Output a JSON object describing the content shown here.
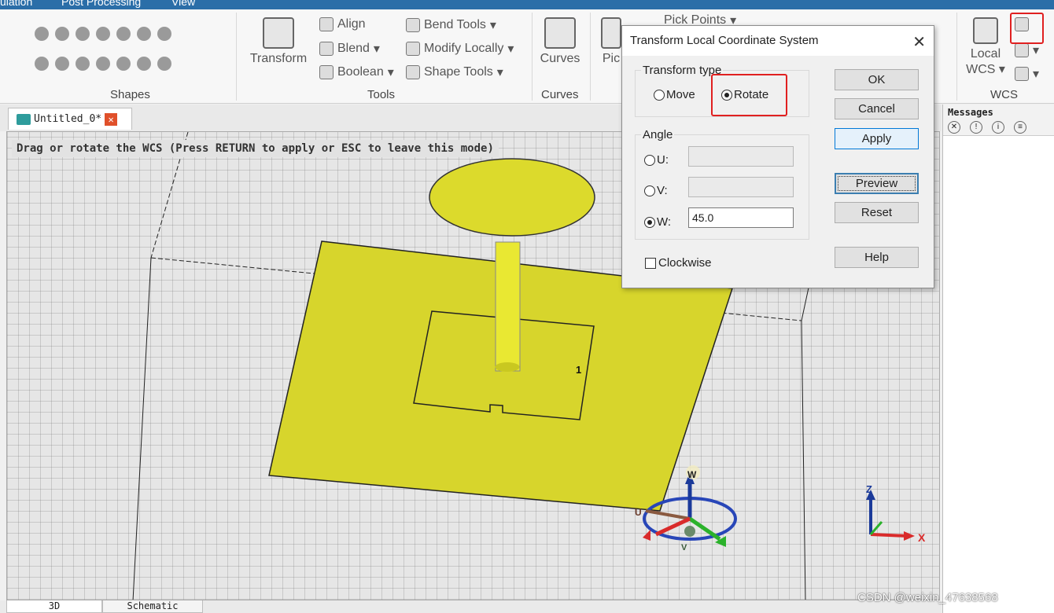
{
  "menu": [
    "ulation",
    "Post Processing",
    "View"
  ],
  "ribbon": {
    "groups": {
      "shapes": "Shapes",
      "tools": "Tools",
      "curves": "Curves",
      "wcs": "WCS"
    },
    "transform": "Transform",
    "align": "Align",
    "blend": "Blend",
    "boolean": "Boolean",
    "bend_tools": "Bend Tools",
    "modify_locally": "Modify Locally",
    "shape_tools": "Shape Tools",
    "curves_btn": "Curves",
    "pick_partial": "Pic",
    "pick_points": "Pick Points",
    "local": "Local",
    "wcs_btn": "WCS"
  },
  "document_tab": {
    "label": "Untitled_0*"
  },
  "viewport": {
    "hint": "Drag or rotate the WCS (Press RETURN to apply or ESC to leave this mode)",
    "port_label": "1",
    "axis_w": "W",
    "axis_u": "U",
    "axis_v": "V",
    "axes": {
      "z": "Z",
      "x": "X"
    }
  },
  "bottom_tabs": [
    "3D",
    "Schematic"
  ],
  "messages": {
    "title": "Messages"
  },
  "dialog": {
    "title": "Transform Local Coordinate System",
    "close": "✕",
    "transform_type_label": "Transform type",
    "move": "Move",
    "rotate": "Rotate",
    "selected_type": "rotate",
    "angle_label": "Angle",
    "u_label": "U:",
    "v_label": "V:",
    "w_label": "W:",
    "u_value": "",
    "v_value": "",
    "w_value": "45.0",
    "clockwise": "Clockwise",
    "buttons": {
      "ok": "OK",
      "cancel": "Cancel",
      "apply": "Apply",
      "preview": "Preview",
      "reset": "Reset",
      "help": "Help"
    }
  },
  "watermark": "CSDN @weixin_47638568",
  "colors": {
    "metal": "#d4d22a",
    "highlight": "#e02020",
    "menubar": "#2b6ea8"
  }
}
